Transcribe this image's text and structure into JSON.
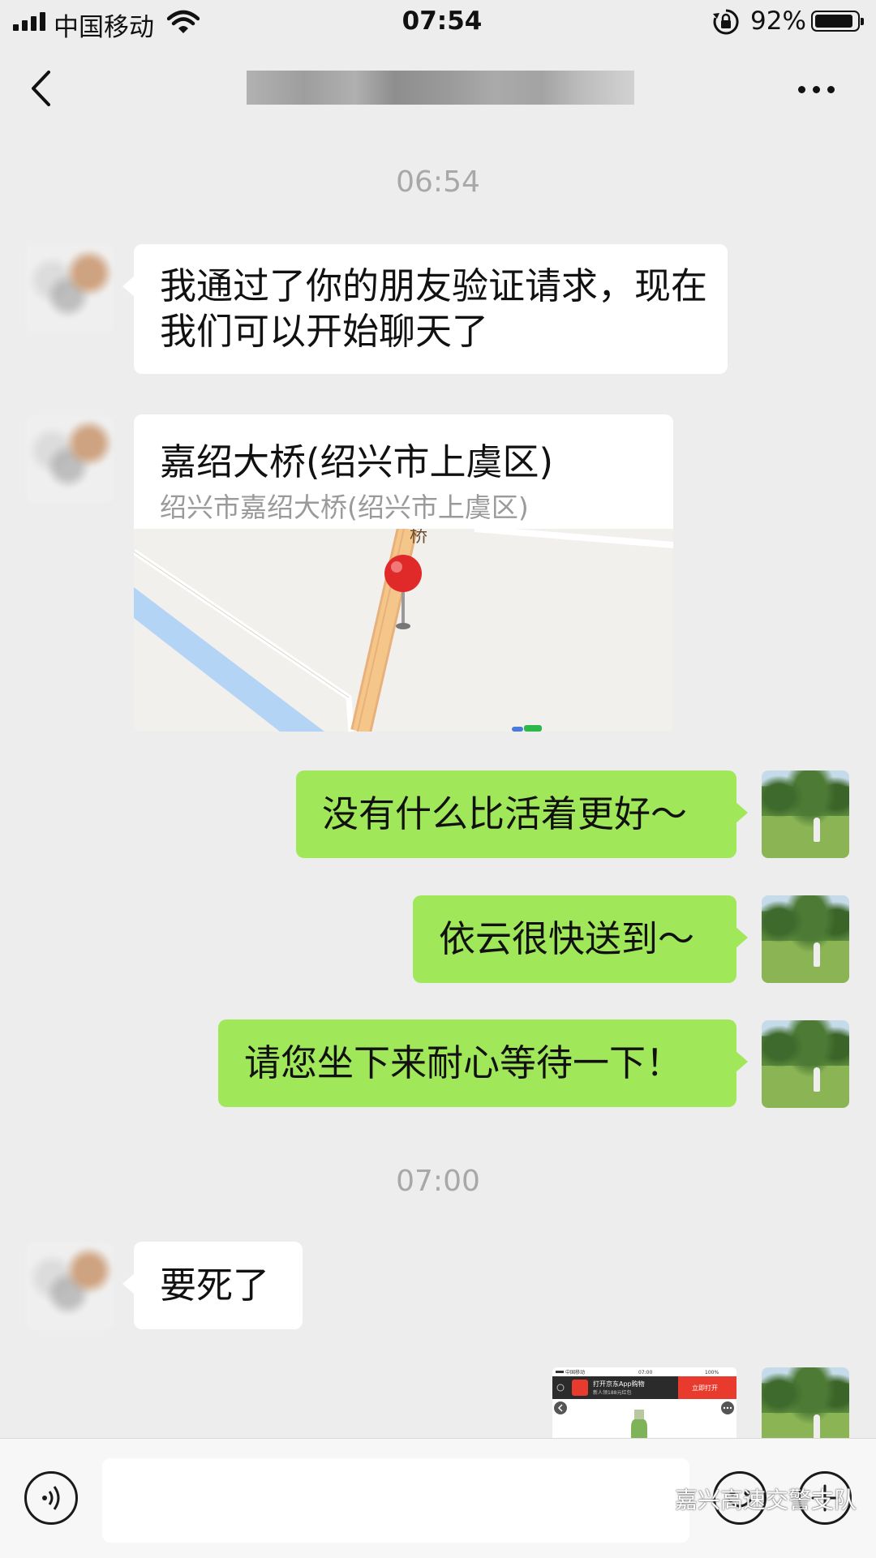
{
  "status": {
    "carrier": "中国移动",
    "time": "07:54",
    "battery_pct": "92%",
    "battery_level": 0.92
  },
  "nav": {
    "back_icon": "chevron-left-icon",
    "more_icon": "more-icon"
  },
  "chat": {
    "timestamps": [
      "06:54",
      "07:00"
    ],
    "messages": [
      {
        "side": "left",
        "text": "我通过了你的朋友验证请求，现在我们可以开始聊天了"
      },
      {
        "side": "left",
        "type": "location",
        "title": "嘉绍大桥(绍兴市上虞区)",
        "address": "绍兴市嘉绍大桥(绍兴市上虞区)",
        "map_label": "桥"
      },
      {
        "side": "right",
        "text": "没有什么比活着更好～"
      },
      {
        "side": "right",
        "text": "依云很快送到～"
      },
      {
        "side": "right",
        "text": "请您坐下来耐心等待一下！"
      },
      {
        "side": "left",
        "text": "要死了"
      },
      {
        "side": "right",
        "type": "image",
        "screen": {
          "carrier": "中国移动",
          "time": "07:00",
          "battery": "100%",
          "banner_title": "打开京东App购物",
          "banner_sub": "新人领188元红包",
          "banner_button": "立即打开"
        }
      }
    ]
  },
  "input_bar": {
    "voice_icon": "voice-icon",
    "emoji_icon": "emoji-icon",
    "plus_icon": "plus-icon",
    "watermark": "嘉兴高速交警支队"
  },
  "colors": {
    "background": "#ededed",
    "outgoing_bubble": "#a0e75a",
    "incoming_bubble": "#ffffff",
    "timestamp": "#a8a8a8",
    "map_pin": "#e02a2a",
    "map_road": "#f5c68a",
    "map_water": "#b3d4f5"
  }
}
